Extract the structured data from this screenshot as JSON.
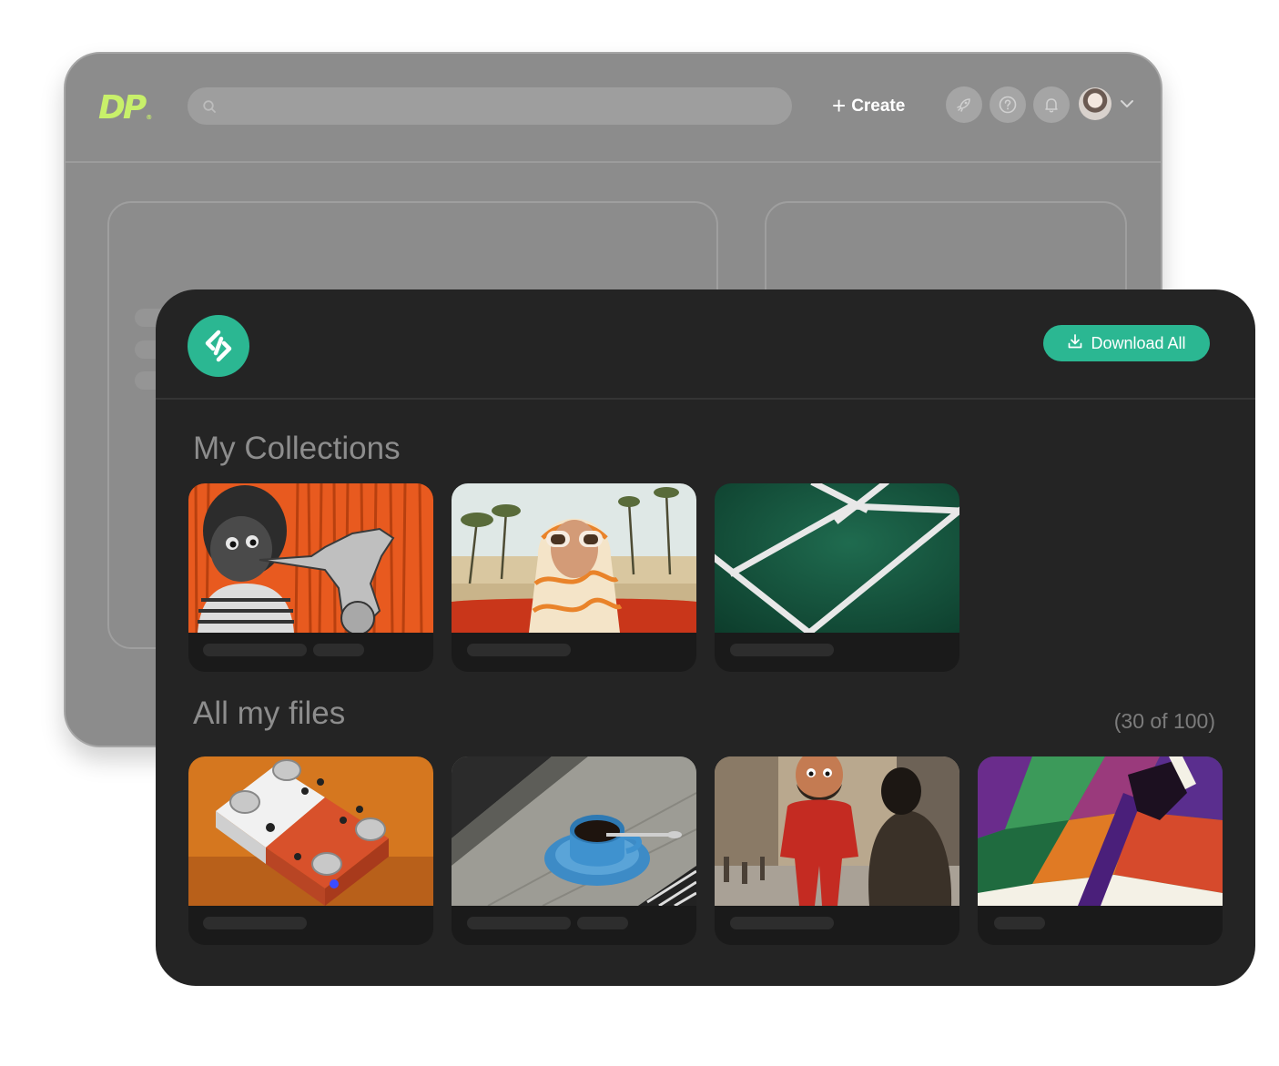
{
  "back_app": {
    "logo_text": "DP",
    "logo_reg": "®",
    "logo_color": "#c8f06a",
    "search": {
      "placeholder": "",
      "value": "",
      "icon": "search-icon"
    },
    "create_label": "Create",
    "icons": [
      "rocket-icon",
      "help-icon",
      "bell-icon"
    ],
    "avatar_icon": "user-avatar",
    "dropdown_icon": "chevron-down-icon"
  },
  "front_app": {
    "accent_color": "#2bb792",
    "logo_icon": "brand-logo-icon",
    "download_all_label": "Download All",
    "download_icon": "download-icon",
    "collections_title": "My Collections",
    "files_title": "All my files",
    "files_count": "(30 of 100)",
    "collections": [
      {
        "thumbnail": "boy-playing-saxophone-illustration"
      },
      {
        "thumbnail": "woman-in-headscarf-and-sunglasses-in-red-car"
      },
      {
        "thumbnail": "green-tennis-court-lines"
      }
    ],
    "files": [
      {
        "thumbnail": "orange-white-modular-synth-pedals"
      },
      {
        "thumbnail": "blue-coffee-cup-on-windowsill"
      },
      {
        "thumbnail": "character-in-red-jumpsuit-on-street"
      },
      {
        "thumbnail": "colorful-geometric-abstract-art"
      }
    ]
  }
}
